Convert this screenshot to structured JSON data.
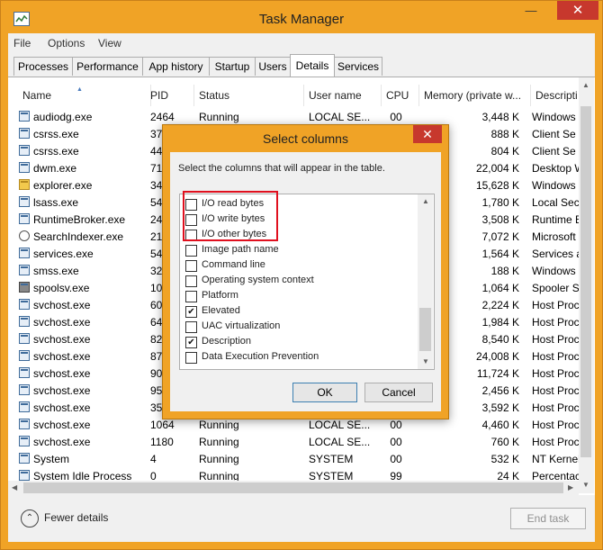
{
  "window": {
    "title": "Task Manager"
  },
  "menu": [
    "File",
    "Options",
    "View"
  ],
  "tabs": [
    "Processes",
    "Performance",
    "App history",
    "Startup",
    "Users",
    "Details",
    "Services"
  ],
  "active_tab": "Details",
  "columns": [
    "Name",
    "PID",
    "Status",
    "User name",
    "CPU",
    "Memory (private w...",
    "Descripti"
  ],
  "rows": [
    {
      "name": "audiodg.exe",
      "pid": "2464",
      "status": "Running",
      "user": "LOCAL SE...",
      "cpu": "00",
      "mem": "3,448 K",
      "desc": "Windows",
      "icon": "app-icon"
    },
    {
      "name": "csrss.exe",
      "pid": "37",
      "status": "",
      "user": "",
      "cpu": "",
      "mem": "888 K",
      "desc": "Client Se",
      "icon": "app-icon"
    },
    {
      "name": "csrss.exe",
      "pid": "44",
      "status": "",
      "user": "",
      "cpu": "",
      "mem": "804 K",
      "desc": "Client Se",
      "icon": "app-icon"
    },
    {
      "name": "dwm.exe",
      "pid": "71",
      "status": "",
      "user": "",
      "cpu": "",
      "mem": "22,004 K",
      "desc": "Desktop W",
      "icon": "app-icon"
    },
    {
      "name": "explorer.exe",
      "pid": "34",
      "status": "",
      "user": "",
      "cpu": "",
      "mem": "15,628 K",
      "desc": "Windows",
      "icon": "folder-icon"
    },
    {
      "name": "lsass.exe",
      "pid": "54",
      "status": "",
      "user": "",
      "cpu": "",
      "mem": "1,780 K",
      "desc": "Local Secu",
      "icon": "app-icon"
    },
    {
      "name": "RuntimeBroker.exe",
      "pid": "24",
      "status": "",
      "user": "",
      "cpu": "",
      "mem": "3,508 K",
      "desc": "Runtime B",
      "icon": "app-icon"
    },
    {
      "name": "SearchIndexer.exe",
      "pid": "21",
      "status": "",
      "user": "",
      "cpu": "",
      "mem": "7,072 K",
      "desc": "Microsoft",
      "icon": "search-icon"
    },
    {
      "name": "services.exe",
      "pid": "54",
      "status": "",
      "user": "",
      "cpu": "",
      "mem": "1,564 K",
      "desc": "Services a",
      "icon": "app-icon"
    },
    {
      "name": "smss.exe",
      "pid": "32",
      "status": "",
      "user": "",
      "cpu": "",
      "mem": "188 K",
      "desc": "Windows",
      "icon": "app-icon"
    },
    {
      "name": "spoolsv.exe",
      "pid": "10",
      "status": "",
      "user": "",
      "cpu": "",
      "mem": "1,064 K",
      "desc": "Spooler Se",
      "icon": "printer-icon"
    },
    {
      "name": "svchost.exe",
      "pid": "60",
      "status": "",
      "user": "",
      "cpu": "",
      "mem": "2,224 K",
      "desc": "Host Proc",
      "icon": "app-icon"
    },
    {
      "name": "svchost.exe",
      "pid": "64",
      "status": "",
      "user": "",
      "cpu": "",
      "mem": "1,984 K",
      "desc": "Host Proc",
      "icon": "app-icon"
    },
    {
      "name": "svchost.exe",
      "pid": "82",
      "status": "",
      "user": "",
      "cpu": "",
      "mem": "8,540 K",
      "desc": "Host Proc",
      "icon": "app-icon"
    },
    {
      "name": "svchost.exe",
      "pid": "87",
      "status": "",
      "user": "",
      "cpu": "",
      "mem": "24,008 K",
      "desc": "Host Proc",
      "icon": "app-icon"
    },
    {
      "name": "svchost.exe",
      "pid": "90",
      "status": "",
      "user": "",
      "cpu": "",
      "mem": "11,724 K",
      "desc": "Host Proc",
      "icon": "app-icon"
    },
    {
      "name": "svchost.exe",
      "pid": "95",
      "status": "",
      "user": "",
      "cpu": "",
      "mem": "2,456 K",
      "desc": "Host Proc",
      "icon": "app-icon"
    },
    {
      "name": "svchost.exe",
      "pid": "35",
      "status": "",
      "user": "",
      "cpu": "",
      "mem": "3,592 K",
      "desc": "Host Proc",
      "icon": "app-icon"
    },
    {
      "name": "svchost.exe",
      "pid": "1064",
      "status": "Running",
      "user": "LOCAL SE...",
      "cpu": "00",
      "mem": "4,460 K",
      "desc": "Host Proc",
      "icon": "app-icon"
    },
    {
      "name": "svchost.exe",
      "pid": "1180",
      "status": "Running",
      "user": "LOCAL SE...",
      "cpu": "00",
      "mem": "760 K",
      "desc": "Host Proc",
      "icon": "app-icon"
    },
    {
      "name": "System",
      "pid": "4",
      "status": "Running",
      "user": "SYSTEM",
      "cpu": "00",
      "mem": "532 K",
      "desc": "NT Kernel",
      "icon": "app-icon"
    },
    {
      "name": "System Idle Process",
      "pid": "0",
      "status": "Running",
      "user": "SYSTEM",
      "cpu": "99",
      "mem": "24 K",
      "desc": "Percentac",
      "icon": "app-icon"
    }
  ],
  "footer": {
    "fewer_details": "Fewer details",
    "end_task": "End task"
  },
  "dialog": {
    "title": "Select columns",
    "instruction": "Select the columns that will appear in the table.",
    "items": [
      {
        "label": "I/O read bytes",
        "checked": false
      },
      {
        "label": "I/O write bytes",
        "checked": false
      },
      {
        "label": "I/O other bytes",
        "checked": false
      },
      {
        "label": "Image path name",
        "checked": false
      },
      {
        "label": "Command line",
        "checked": false
      },
      {
        "label": "Operating system context",
        "checked": false
      },
      {
        "label": "Platform",
        "checked": false
      },
      {
        "label": "Elevated",
        "checked": true
      },
      {
        "label": "UAC virtualization",
        "checked": false
      },
      {
        "label": "Description",
        "checked": true
      },
      {
        "label": "Data Execution Prevention",
        "checked": false
      }
    ],
    "ok": "OK",
    "cancel": "Cancel"
  },
  "colors": {
    "accent": "#f0a326",
    "close_red": "#c7382d",
    "highlight_red": "#e0101e"
  }
}
